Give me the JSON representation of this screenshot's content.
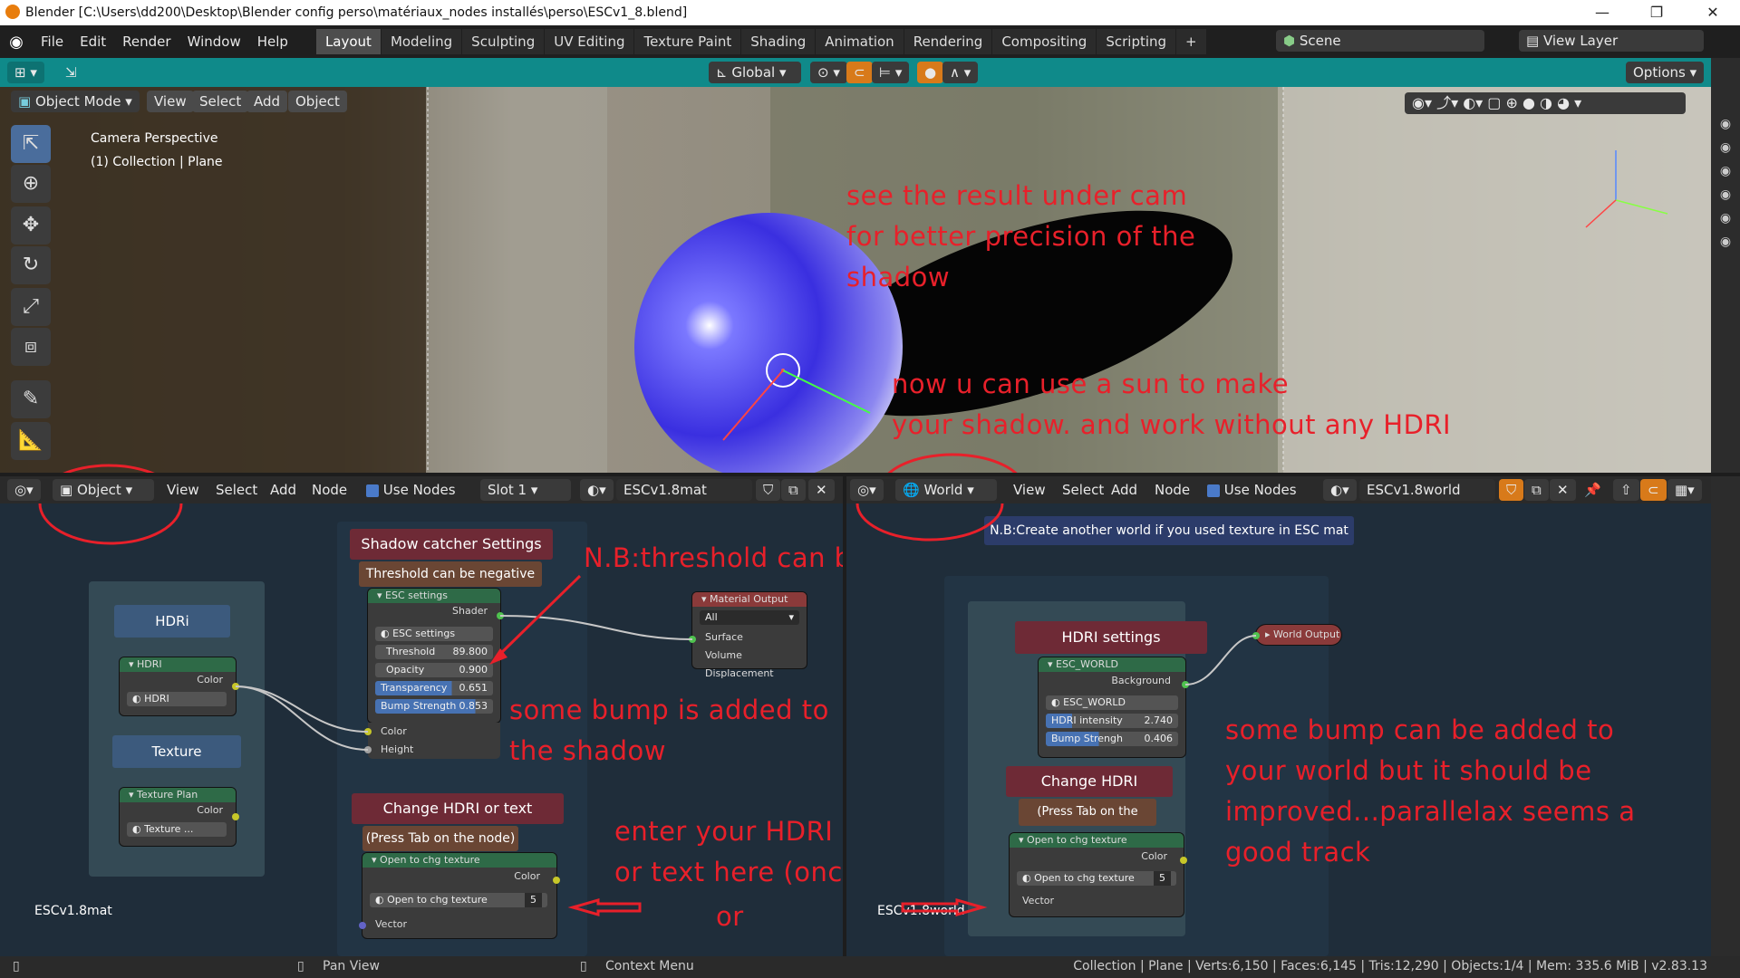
{
  "window": {
    "title": "Blender [C:\\Users\\dd200\\Desktop\\Blender config perso\\matériaux_nodes installés\\perso\\ESCv1_8.blend]",
    "minimize": "—",
    "maximize": "❐",
    "close": "✕"
  },
  "menu": [
    "File",
    "Edit",
    "Render",
    "Window",
    "Help"
  ],
  "workspaces": [
    "Layout",
    "Modeling",
    "Sculpting",
    "UV Editing",
    "Texture Paint",
    "Shading",
    "Animation",
    "Rendering",
    "Compositing",
    "Scripting",
    "+"
  ],
  "active_workspace": "Layout",
  "scene": {
    "label": "Scene",
    "view_layer": "View Layer"
  },
  "viewport_header": {
    "orientation": "Global",
    "options": "Options",
    "mode": "Object Mode",
    "menus": [
      "View",
      "Select",
      "Add",
      "Object"
    ]
  },
  "viewport": {
    "info_line1": "Camera Perspective",
    "info_line2": "(1) Collection | Plane"
  },
  "left_node_editor": {
    "type": "Object",
    "menus": [
      "View",
      "Select",
      "Add",
      "Node"
    ],
    "use_nodes": "Use Nodes",
    "slot": "Slot 1",
    "material": "ESCv1.8mat",
    "footer_label": "ESCv1.8mat",
    "frames": {
      "hdri": "HDRi",
      "texture": "Texture",
      "shadow_settings": "Shadow catcher Settings",
      "threshold_note": "Threshold can be negative",
      "change_hdri": "Change HDRI or text",
      "press_tab": "(Press Tab on the node)"
    },
    "hdri_node": {
      "title": "HDRI",
      "output": "Color",
      "group": "HDRI"
    },
    "texture_node": {
      "title": "Texture Plan",
      "output": "Color",
      "group": "Texture ..."
    },
    "esc_node": {
      "title": "ESC settings",
      "output": "Shader",
      "group": "ESC settings",
      "threshold_label": "Threshold",
      "threshold": "89.800",
      "opacity_label": "Opacity",
      "opacity": "0.900",
      "transparency_label": "Transparency",
      "transparency": "0.651",
      "bump_label": "Bump Strength",
      "bump": "0.853",
      "in_color": "Color",
      "in_height": "Height"
    },
    "material_output": {
      "title": "Material Output",
      "target": "All",
      "surface": "Surface",
      "volume": "Volume",
      "displacement": "Displacement"
    },
    "tex_node": {
      "title": "Open to chg texture",
      "output": "Color",
      "group": "Open to chg texture",
      "users": "5",
      "input": "Vector"
    }
  },
  "right_node_editor": {
    "type": "World",
    "menus": [
      "View",
      "Select",
      "Add",
      "Node"
    ],
    "use_nodes": "Use Nodes",
    "world": "ESCv1.8world",
    "footer_label": "ESCv1.8world",
    "note": "N.B:Create another world if you used texture in ESC mat",
    "frames": {
      "hdri_settings": "HDRI settings",
      "change_hdri": "Change HDRI",
      "press_tab": "(Press Tab on the node)"
    },
    "world_output": "World Output",
    "esc_world": {
      "title": "ESC_WORLD",
      "output": "Background",
      "group": "ESC_WORLD",
      "intensity_label": "HDRI intensity",
      "intensity": "2.740",
      "bump_label": "Bump Strengh",
      "bump": "0.406"
    },
    "tex_node": {
      "title": "Open to chg texture",
      "output": "Color",
      "group": "Open to chg texture",
      "users": "5",
      "input": "Vector"
    }
  },
  "annotations": {
    "cam": "see the result under cam\nfor better precision of the\nshadow",
    "sun": "now u can use a sun to make\nyour shadow. and work without any HDRI",
    "threshold": "N.B:threshold can be negative",
    "bump_shadow": "some bump is added to\nthe shadow",
    "enter_hdri": "enter your HDRI\nor text here (once)",
    "or": "or",
    "bump_world": "some bump can be added to\nyour world but it should be\nimproved...parallelax seems a\ngood track"
  },
  "statusbar": {
    "pan": "Pan View",
    "context": "Context Menu",
    "stats": "Collection | Plane | Verts:6,150 | Faces:6,145 | Tris:12,290 | Objects:1/4 | Mem: 335.6 MiB | v2.83.13"
  },
  "colors": {
    "accent": "#0f8a8a",
    "annotation": "#e8202a",
    "frame_maroon": "#6e2a36",
    "frame_brown": "#6a4634"
  }
}
